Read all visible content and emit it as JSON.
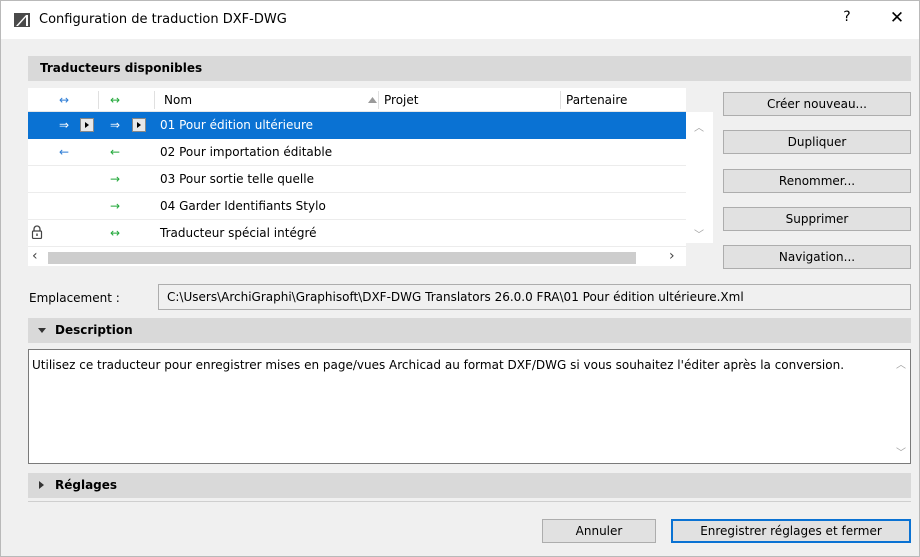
{
  "window": {
    "title": "Configuration de traduction DXF-DWG",
    "help_label": "?",
    "close_label": "✕"
  },
  "translators_section": {
    "title": "Traducteurs disponibles",
    "columns": {
      "col1_arrow": "↔",
      "col2_arrow": "↔",
      "name": "Nom",
      "project": "Projet",
      "partner": "Partenaire"
    },
    "rows": [
      {
        "arrow1": "⇒",
        "arrow2": "⇒",
        "name": "01 Pour édition ultérieure",
        "selected": true
      },
      {
        "arrow1": "←",
        "arrow2": "←",
        "name": "02 Pour importation éditable",
        "selected": false
      },
      {
        "arrow1": "",
        "arrow2": "→",
        "name": "03 Pour sortie telle quelle",
        "selected": false
      },
      {
        "arrow1": "",
        "arrow2": "→",
        "name": "04 Garder Identifiants Stylo",
        "selected": false
      },
      {
        "arrow1": "",
        "arrow2": "↔",
        "name": "Traducteur spécial intégré",
        "selected": false,
        "locked": true
      }
    ]
  },
  "side_buttons": {
    "create": "Créer nouveau...",
    "duplicate": "Dupliquer",
    "rename": "Renommer...",
    "delete": "Supprimer",
    "navigate": "Navigation..."
  },
  "location": {
    "label": "Emplacement :",
    "path": "C:\\Users\\ArchiGraphi\\Graphisoft\\DXF-DWG Translators 26.0.0 FRA\\01 Pour édition ultérieure.Xml"
  },
  "description": {
    "title": "Description",
    "text": "Utilisez ce traducteur pour enregistrer mises en page/vues Archicad au format DXF/DWG si vous souhaitez l'éditer après la conversion."
  },
  "settings": {
    "title": "Réglages"
  },
  "footer": {
    "cancel": "Annuler",
    "save": "Enregistrer réglages et fermer"
  },
  "colors": {
    "selection": "#0a72d3",
    "arrow_blue": "#2d7dd6",
    "arrow_green": "#22a83a"
  },
  "icons": {
    "app": "archicad-icon",
    "lock": "lock-icon",
    "sort": "sort-ascending-icon"
  }
}
